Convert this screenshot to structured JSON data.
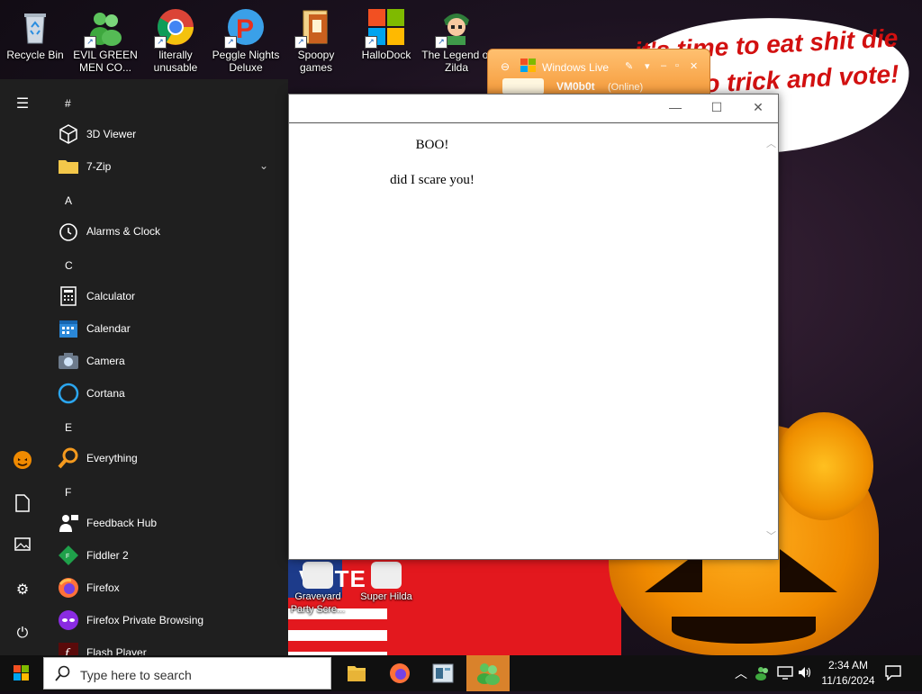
{
  "desktop": {
    "icons": [
      {
        "label": "Recycle Bin",
        "icon": "recycle-bin-icon"
      },
      {
        "label": "EVIL GREEN MEN CO...",
        "icon": "msn-people-icon"
      },
      {
        "label": "literally unusable",
        "icon": "chrome-icon"
      },
      {
        "label": "Peggle Nights Deluxe",
        "icon": "peggle-icon"
      },
      {
        "label": "Spoopy games",
        "icon": "folder-games-icon"
      },
      {
        "label": "HalloDock",
        "icon": "windows-logo-icon"
      },
      {
        "label": "The Legend of Zilda",
        "icon": "zilda-character-icon"
      }
    ],
    "bottom_icons": [
      {
        "label": "Graveyard Party Scre...",
        "icon": "qr-shortcut-icon"
      },
      {
        "label": "Super Hilda",
        "icon": "qr-shortcut-icon"
      }
    ],
    "wallpaper_text": "it's time to eat shit die and go trick and vote!",
    "flag_text": "VOTE"
  },
  "messenger": {
    "title": "Windows Live",
    "user": "VM0b0t",
    "status": "(Online)"
  },
  "start_menu": {
    "rail": [
      "hamburger-icon",
      "user-avatar-icon",
      "documents-icon",
      "pictures-icon",
      "settings-icon",
      "power-icon"
    ],
    "sections": {
      "hash": "#",
      "a": "A",
      "c": "C",
      "e": "E",
      "f": "F"
    },
    "apps": {
      "viewer3d": "3D Viewer",
      "zip": "7-Zip",
      "alarms": "Alarms & Clock",
      "calculator": "Calculator",
      "calendar": "Calendar",
      "camera": "Camera",
      "cortana": "Cortana",
      "everything": "Everything",
      "feedback": "Feedback Hub",
      "fiddler": "Fiddler 2",
      "firefox": "Firefox",
      "firefox_private": "Firefox Private Browsing",
      "flash": "Flash Player"
    }
  },
  "boo_window": {
    "heading": "BOO!",
    "message": "did I scare you!"
  },
  "taskbar": {
    "search_placeholder": "Type here to search",
    "time": "2:34 AM",
    "date": "11/16/2024"
  }
}
